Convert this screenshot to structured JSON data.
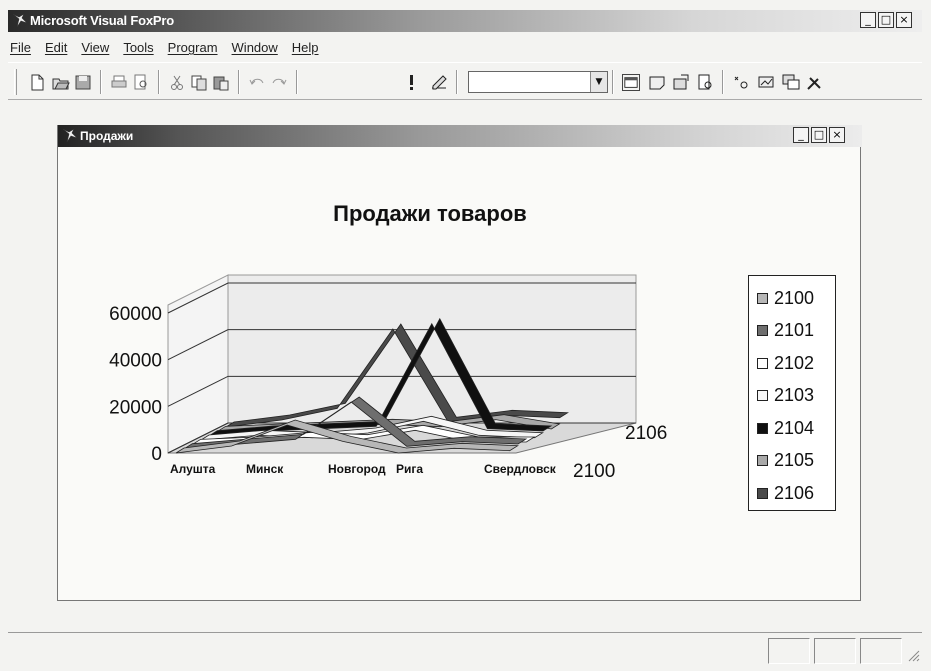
{
  "app": {
    "title": "Microsoft Visual FoxPro"
  },
  "menu": [
    "File",
    "Edit",
    "View",
    "Tools",
    "Program",
    "Window",
    "Help"
  ],
  "toolbar": {
    "icons": [
      "new-icon",
      "open-icon",
      "save-icon",
      "print-icon",
      "print-preview-icon",
      "cut-icon",
      "copy-icon",
      "paste-icon",
      "undo-icon",
      "redo-icon",
      "run-icon",
      "modify-form-icon",
      "command-window-icon",
      "data-session-icon",
      "properties-icon",
      "code-icon",
      "form-designer-icon",
      "class-browser-icon",
      "component-gallery-icon",
      "builder-icon"
    ],
    "combo_value": ""
  },
  "window_controls": {
    "minimize": "_",
    "maximize": "□",
    "close": "×"
  },
  "child": {
    "title": "Продажи"
  },
  "chart_data": {
    "type": "line",
    "title": "Продажи товаров",
    "categories": [
      "Алушта",
      "Минск",
      "Новгород",
      "Рига",
      "Свердловск"
    ],
    "depth_labels": [
      "2106",
      "2100"
    ],
    "y_ticks": [
      "0",
      "20000",
      "40000",
      "60000"
    ],
    "ylim": [
      0,
      60000
    ],
    "grid": true,
    "legend_position": "right",
    "series": [
      {
        "name": "2100",
        "color": "#b7b7b7",
        "values": [
          0,
          3000,
          12000,
          5000,
          0,
          2000,
          1000
        ]
      },
      {
        "name": "2101",
        "color": "#6e6e6e",
        "values": [
          0,
          2000,
          4000,
          20000,
          1000,
          3000,
          2000
        ]
      },
      {
        "name": "2102",
        "color": "#ffffff",
        "values": [
          0,
          1000,
          3000,
          2000,
          6000,
          1000,
          1000
        ]
      },
      {
        "name": "2103",
        "color": "#f6f6f6",
        "values": [
          0,
          2000,
          1000,
          3000,
          8000,
          2000,
          1000
        ]
      },
      {
        "name": "2104",
        "color": "#101010",
        "values": [
          0,
          2000,
          3000,
          4000,
          48000,
          3000,
          2000
        ]
      },
      {
        "name": "2105",
        "color": "#a9a9a9",
        "values": [
          0,
          1000,
          2000,
          3000,
          2000,
          5000,
          1000
        ]
      },
      {
        "name": "2106",
        "color": "#4a4a4a",
        "values": [
          0,
          3000,
          8000,
          42000,
          2000,
          5000,
          4000
        ]
      }
    ]
  }
}
